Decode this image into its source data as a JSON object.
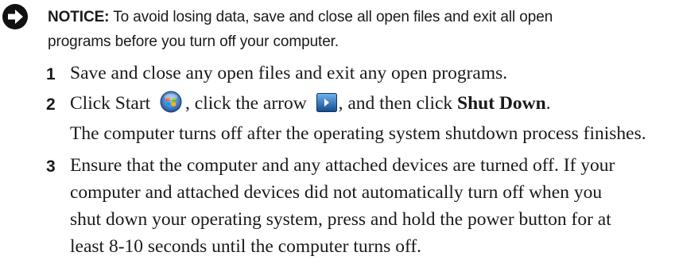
{
  "notice": {
    "label": "NOTICE:",
    "text_line1": " To avoid losing data, save and close all open files and exit all open",
    "text_line2": "programs before you turn off your computer."
  },
  "steps": [
    {
      "number": "1",
      "text": "Save and close any open files and exit any open programs."
    },
    {
      "number": "2",
      "text_before_start": "Click Start ",
      "text_after_start": ", click the arrow ",
      "text_after_arrow": ",  and then click ",
      "bold_text": "Shut Down",
      "text_end": ".",
      "note": "The computer turns off after the operating system shutdown process finishes."
    },
    {
      "number": "3",
      "lines": [
        "Ensure that the computer and any attached devices are turned off. If your",
        "computer and attached devices did not automatically turn off when you",
        "shut down your operating system, press and hold the power button for at",
        "least 8-10 seconds until the computer turns off."
      ]
    }
  ],
  "icons": {
    "notice": "notice-arrow-icon",
    "start": "windows-start-orb-icon",
    "arrow": "shutdown-arrow-button-icon"
  },
  "colors": {
    "text": "#1a1a1a",
    "notice_icon": "#111111",
    "arrow_button_bg": "#1f5fb0"
  }
}
